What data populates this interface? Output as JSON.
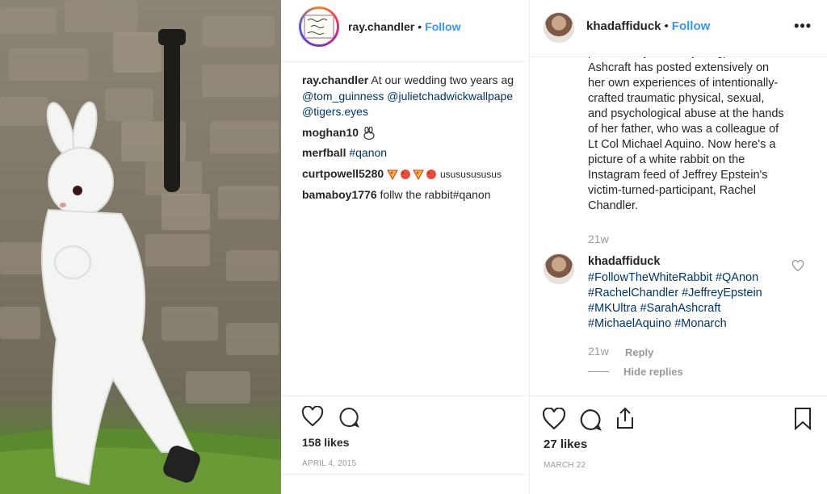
{
  "left_post": {
    "username": "ray.chandler",
    "follow_label": "Follow",
    "avatar_text": "Strike as the moment strikes",
    "comments": [
      {
        "user": "ray.chandler",
        "text": "At our wedding two years ag",
        "mentions": [
          "@tom_guinness",
          "@julietchadwickwallpape",
          "@tigers.eyes"
        ]
      },
      {
        "user": "moghan10",
        "text": "",
        "icon": "rabbit-emoji-icon"
      },
      {
        "user": "merfball",
        "text": "#qanon"
      },
      {
        "user": "curtpowell5280",
        "text": "usususususus",
        "icons": [
          "pizza-emoji-icon",
          "red-ball-emoji-icon",
          "pizza-emoji-icon",
          "red-ball-emoji-icon"
        ]
      },
      {
        "user": "bamaboy1776",
        "text": "follw the rabbit#qanon"
      }
    ],
    "likes": "158 likes",
    "date": "APRIL 4, 2015"
  },
  "right_post": {
    "username": "khadaffiduck",
    "follow_label": "Follow",
    "more_label": "•••",
    "caption_lines": [
      "possible if you start young). Sarah",
      "Ashcraft has posted extensively on",
      "her own experiences of intentionally-",
      "crafted traumatic physical, sexual,",
      "and psychological abuse at the hands",
      "of her father, who was a colleague of",
      "Lt Col Michael Aquino. Now here's a",
      "picture of a white rabbit on the",
      "Instagram feed of Jeffrey Epstein's",
      "victim-turned-participant, Rachel",
      "Chandler."
    ],
    "caption_time": "21w",
    "reply": {
      "user": "khadaffiduck",
      "lines": [
        "#FollowTheWhiteRabbit #QAnon",
        "#RachelChandler #JeffreyEpstein",
        "#MKUltra #SarahAshcraft",
        "#MichaelAquino #Monarch"
      ],
      "time": "21w",
      "reply_label": "Reply",
      "hide_replies_label": "Hide replies"
    },
    "likes": "27 likes",
    "date": "MARCH 22"
  },
  "icons": [
    "heart-icon",
    "comment-icon",
    "share-icon",
    "bookmark-icon",
    "more-options-icon"
  ],
  "colors": {
    "link_blue": "#3897f0",
    "hashtag": "#003569",
    "muted": "#999999",
    "text": "#262626"
  }
}
